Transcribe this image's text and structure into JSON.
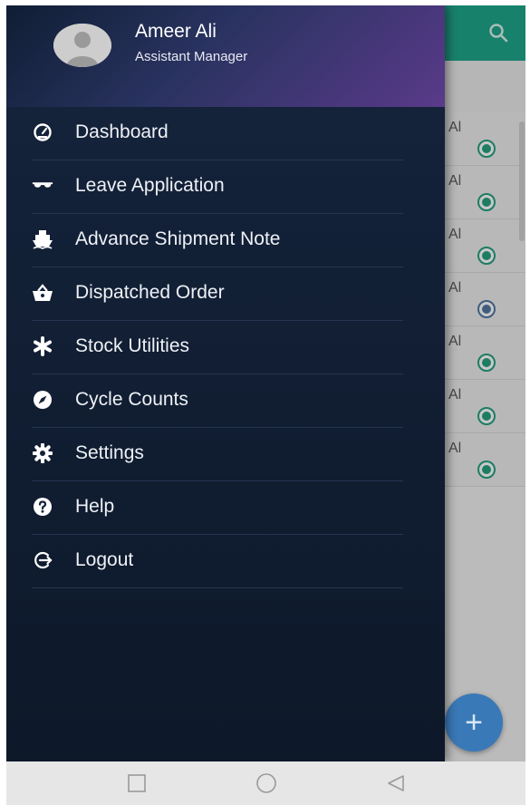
{
  "user": {
    "name": "Ameer Ali",
    "role": "Assistant Manager"
  },
  "menu": [
    {
      "label": "Dashboard",
      "icon": "dashboard-icon"
    },
    {
      "label": "Leave Application",
      "icon": "sunglasses-icon"
    },
    {
      "label": "Advance Shipment Note",
      "icon": "ship-icon"
    },
    {
      "label": "Dispatched Order",
      "icon": "basket-icon"
    },
    {
      "label": "Stock Utilities",
      "icon": "asterisk-icon"
    },
    {
      "label": "Cycle Counts",
      "icon": "compass-icon"
    },
    {
      "label": "Settings",
      "icon": "gear-icon"
    },
    {
      "label": "Help",
      "icon": "help-icon"
    },
    {
      "label": "Logout",
      "icon": "logout-icon"
    }
  ],
  "background_list": {
    "row_text": "Al",
    "rows": [
      {
        "status_color": "#26a17e"
      },
      {
        "status_color": "#26a17e"
      },
      {
        "status_color": "#26a17e"
      },
      {
        "status_color": "#5277a3"
      },
      {
        "status_color": "#26a17e"
      },
      {
        "status_color": "#26a17e"
      },
      {
        "status_color": "#26a17e"
      }
    ]
  },
  "fab": {
    "label": "+"
  },
  "colors": {
    "toolbar": "#1fa68a",
    "drawer": "#13223a",
    "fab": "#3a79b7",
    "accent": "#26a17e"
  }
}
